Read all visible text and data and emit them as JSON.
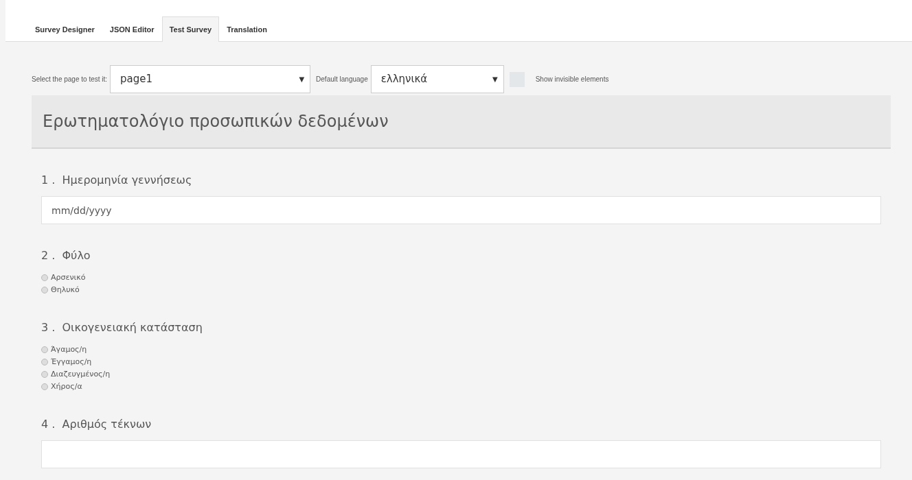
{
  "tabs": [
    {
      "label": "Survey Designer",
      "selected": false
    },
    {
      "label": "JSON Editor",
      "selected": false
    },
    {
      "label": "Test Survey",
      "selected": true
    },
    {
      "label": "Translation",
      "selected": false
    }
  ],
  "toolbar": {
    "page_label": "Select the page to test it:",
    "page_value": "page1",
    "page_caret": "▼",
    "language_label": "Default language",
    "language_value": "ελληνικά",
    "language_caret": "▼",
    "show_invisible": {
      "label": "Show invisible elements",
      "checked": false
    }
  },
  "survey": {
    "title": "Ερωτηματολόγιο προσωπικών δεδομένων",
    "questions": [
      {
        "number": "1 .",
        "title": "Ημερομηνία γεννήσεως",
        "kind": "text",
        "placeholder": "mm/dd/yyyy"
      },
      {
        "number": "2 .",
        "title": "Φύλο",
        "kind": "radiogroup",
        "choices": [
          {
            "label": "Αρσενικό",
            "selected": false
          },
          {
            "label": "Θηλυκό",
            "selected": false
          }
        ]
      },
      {
        "number": "3 .",
        "title": "Οικογενειακή κατάσταση",
        "kind": "radiogroup",
        "choices": [
          {
            "label": "Άγαμος/η",
            "selected": false
          },
          {
            "label": "Έγγαμος/η",
            "selected": false
          },
          {
            "label": "Διαζευγμένος/η",
            "selected": false
          },
          {
            "label": "Χήρος/α",
            "selected": false
          }
        ]
      },
      {
        "number": "4 .",
        "title": "Αριθμός τέκνων",
        "kind": "text"
      }
    ]
  }
}
